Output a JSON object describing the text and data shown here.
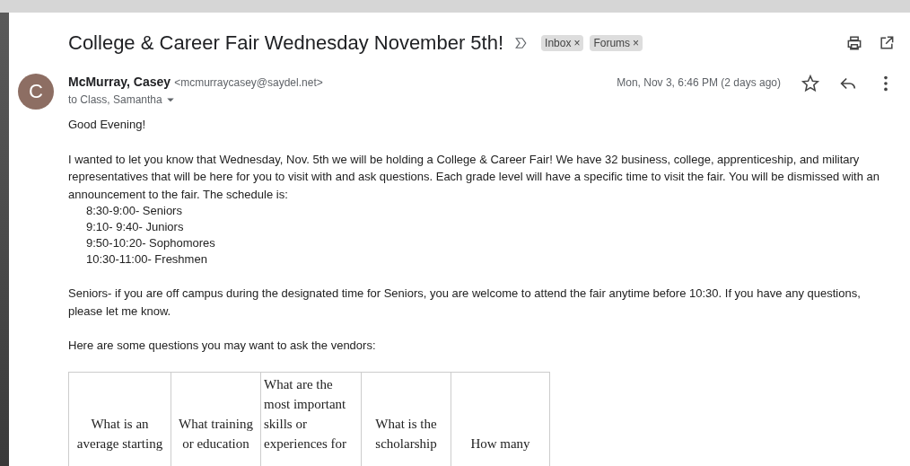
{
  "email": {
    "subject": "College & Career Fair Wednesday November 5th!",
    "labels": [
      {
        "text": "Inbox",
        "remove": "×"
      },
      {
        "text": "Forums",
        "remove": "×"
      }
    ],
    "sender": {
      "initial": "C",
      "name": "McMurray, Casey",
      "address": "<mcmurraycasey@saydel.net>",
      "recipients": "to Class, Samantha",
      "date": "Mon, Nov 3, 6:46 PM (2 days ago)",
      "starred": false
    },
    "body": [
      {
        "kind": "paragraph",
        "text": "Good Evening!"
      },
      {
        "kind": "paragraph",
        "text": "I wanted to let you know that Wednesday, Nov. 5th we will be holding a College & Career Fair! We have 32 business, college, apprenticeship, and military representatives that will be here for you to visit with and ask questions. Each grade level will have a specific time to visit the fair. You will be dismissed with an announcement to the fair. The schedule is:"
      },
      {
        "kind": "schedule",
        "items": [
          "8:30-9:00- Seniors",
          "9:10- 9:40- Juniors",
          "9:50-10:20- Sophomores",
          "10:30-11:00- Freshmen"
        ]
      },
      {
        "kind": "paragraph",
        "text": "Seniors- if you are off campus during the designated time for Seniors, you are welcome to attend the fair anytime before 10:30. If you have any questions, please let me know."
      },
      {
        "kind": "paragraph",
        "text": "Here are some questions you may want to ask the vendors:"
      },
      {
        "kind": "table",
        "cells": [
          {
            "text": "What is an\naverage starting",
            "centered": true
          },
          {
            "text": "What training\nor education",
            "centered": true
          },
          {
            "text": "What are the\nmost important\nskills or\nexperiences for",
            "centered": false
          },
          {
            "text": "What is the\nscholarship",
            "centered": true
          },
          {
            "text": "How many",
            "centered": true
          }
        ]
      }
    ]
  }
}
